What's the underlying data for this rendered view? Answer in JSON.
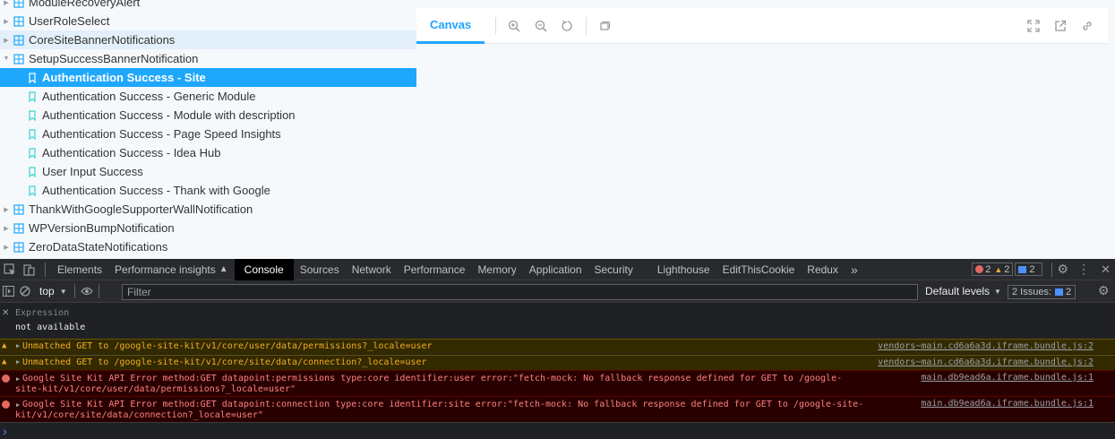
{
  "tree": {
    "items": [
      {
        "label": "ModuleRecoveryAlert",
        "kind": "component",
        "state": "collapsed"
      },
      {
        "label": "UserRoleSelect",
        "kind": "component",
        "state": "collapsed"
      },
      {
        "label": "CoreSiteBannerNotifications",
        "kind": "component",
        "state": "collapsed-hover"
      },
      {
        "label": "SetupSuccessBannerNotification",
        "kind": "component",
        "state": "expanded"
      },
      {
        "label": "Authentication Success - Site",
        "kind": "story",
        "state": "selected"
      },
      {
        "label": "Authentication Success - Generic Module",
        "kind": "story",
        "state": ""
      },
      {
        "label": "Authentication Success - Module with description",
        "kind": "story",
        "state": ""
      },
      {
        "label": "Authentication Success - Page Speed Insights",
        "kind": "story",
        "state": ""
      },
      {
        "label": "Authentication Success - Idea Hub",
        "kind": "story",
        "state": ""
      },
      {
        "label": "User Input Success",
        "kind": "story",
        "state": ""
      },
      {
        "label": "Authentication Success - Thank with Google",
        "kind": "story",
        "state": ""
      },
      {
        "label": "ThankWithGoogleSupporterWallNotification",
        "kind": "component",
        "state": "collapsed"
      },
      {
        "label": "WPVersionBumpNotification",
        "kind": "component",
        "state": "collapsed"
      },
      {
        "label": "ZeroDataStateNotifications",
        "kind": "component",
        "state": "collapsed"
      }
    ]
  },
  "preview": {
    "tab_label": "Canvas",
    "toolbar_icons": [
      "zoom-in-icon",
      "zoom-out-icon",
      "reset-zoom-icon",
      "background-icon"
    ],
    "right_icons": [
      "fullscreen-icon",
      "open-new-tab-icon",
      "copy-link-icon"
    ]
  },
  "devtools": {
    "tabs": [
      "Elements",
      "Performance insights",
      "Console",
      "Sources",
      "Network",
      "Performance",
      "Memory",
      "Application",
      "Security",
      "Lighthouse",
      "EditThisCookie",
      "Redux"
    ],
    "active_tab": "Console",
    "more_tabs": "»",
    "error_count": "2",
    "warning_count": "2",
    "info_count": "2",
    "context": "top",
    "filter_placeholder": "Filter",
    "levels": "Default levels",
    "issues": "2 Issues:",
    "issues_count": "2",
    "expression_label": "Expression",
    "expression_value": "not available",
    "messages": [
      {
        "level": "warning",
        "text": "Unmatched GET to /google-site-kit/v1/core/user/data/permissions?_locale=user",
        "source": "vendors~main.cd6a6a3d.iframe.bundle.js:2"
      },
      {
        "level": "warning",
        "text": "Unmatched GET to /google-site-kit/v1/core/site/data/connection?_locale=user",
        "source": "vendors~main.cd6a6a3d.iframe.bundle.js:2"
      },
      {
        "level": "error",
        "text": "Google Site Kit API Error method:GET datapoint:permissions type:core identifier:user error:\"fetch-mock: No fallback response defined for GET to /google-site-kit/v1/core/user/data/permissions?_locale=user\"",
        "source": "main.db9ead6a.iframe.bundle.js:1"
      },
      {
        "level": "error",
        "text": "Google Site Kit API Error method:GET datapoint:connection type:core identifier:site error:\"fetch-mock: No fallback response defined for GET to /google-site-kit/v1/core/site/data/connection?_locale=user\"",
        "source": "main.db9ead6a.iframe.bundle.js:1"
      }
    ],
    "prompt": "›"
  },
  "colors": {
    "accent": "#1ea7fd",
    "devtools_bg": "#202124",
    "warning": "#f2ab26",
    "error": "#ff8080"
  }
}
